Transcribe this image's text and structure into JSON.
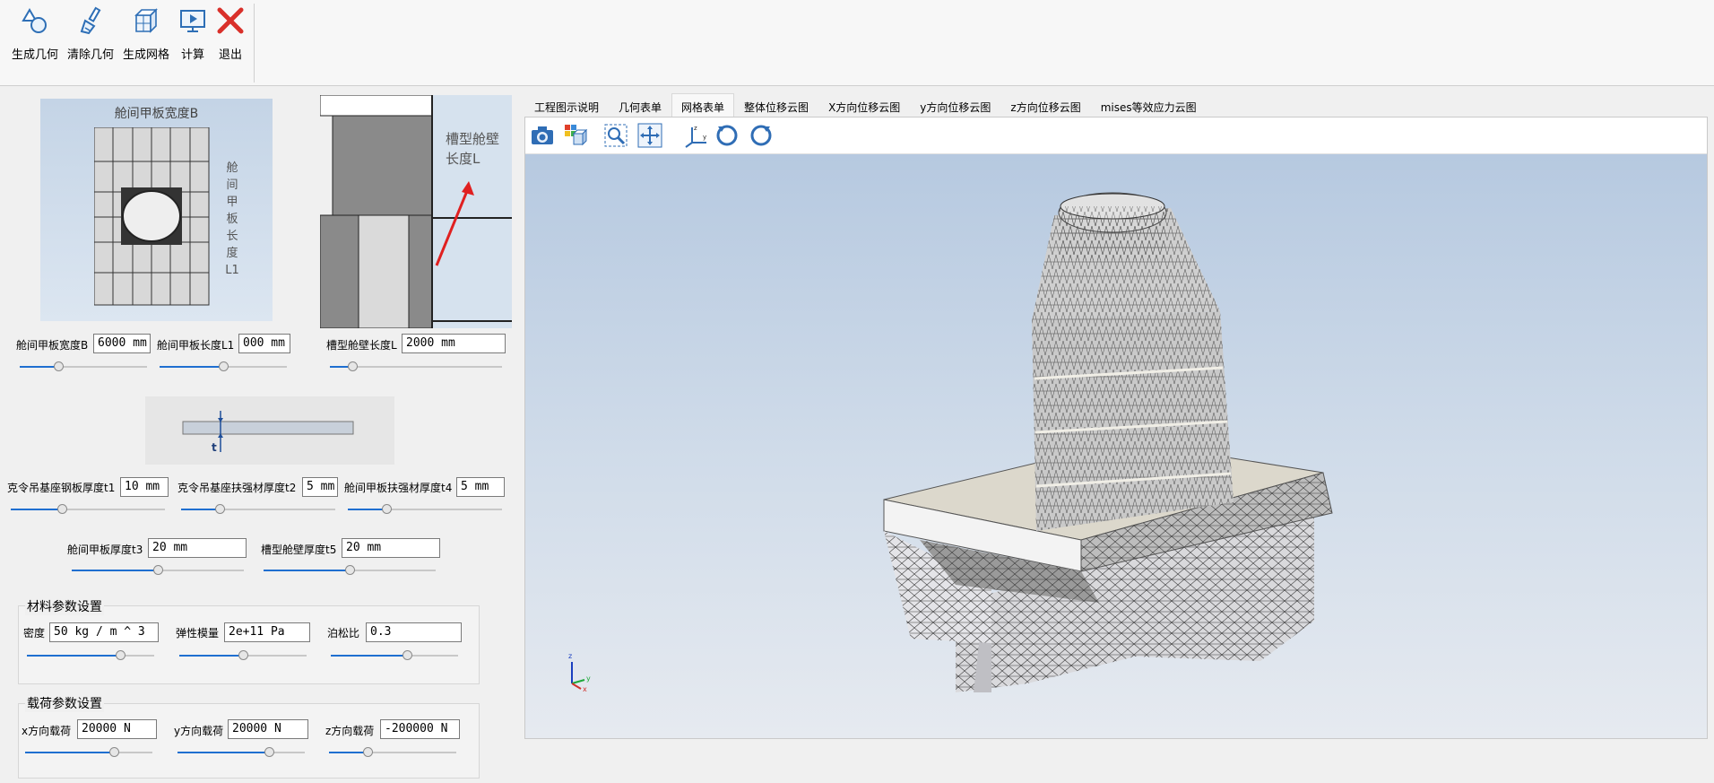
{
  "toolbar": {
    "buttons": [
      {
        "label": "生成几何",
        "icon": "shapes-icon"
      },
      {
        "label": "清除几何",
        "icon": "brush-icon"
      },
      {
        "label": "生成网格",
        "icon": "cube-grid-icon"
      },
      {
        "label": "计算",
        "icon": "monitor-play-icon"
      },
      {
        "label": "退出",
        "icon": "close-icon"
      }
    ]
  },
  "diagrams": {
    "deck_title": "舱间甲板宽度B",
    "deck_length_label": "舱间甲板长度L1",
    "bulkhead_label_1": "槽型舱壁",
    "bulkhead_label_2": "长度L",
    "thickness_marker": "t"
  },
  "params": {
    "deck_width": {
      "label": "舱间甲板宽度B",
      "value": "6000 mm",
      "slider": 0.3
    },
    "deck_length": {
      "label": "舱间甲板长度L1",
      "value": "000 mm",
      "slider": 0.5
    },
    "bulkhead_length": {
      "label": "槽型舱壁长度L",
      "value": "2000 mm",
      "slider": 0.13
    },
    "crane_base_t1": {
      "label": "克令吊基座钢板厚度t1",
      "value": "10 mm",
      "slider": 0.33
    },
    "crane_stiffener_t2": {
      "label": "克令吊基座扶强材厚度t2",
      "value": "5 mm",
      "slider": 0.25
    },
    "deck_stiffener_t4": {
      "label": "舱间甲板扶强材厚度t4",
      "value": "5 mm",
      "slider": 0.25
    },
    "deck_t3": {
      "label": "舱间甲板厚度t3",
      "value": "20 mm",
      "slider": 0.5
    },
    "bulkhead_t5": {
      "label": "槽型舱壁厚度t5",
      "value": "20 mm",
      "slider": 0.5
    }
  },
  "material": {
    "title": "材料参数设置",
    "density": {
      "label": "密度",
      "value": "50 kg / m ^ 3",
      "slider": 0.73
    },
    "modulus": {
      "label": "弹性模量",
      "value": "2e+11 Pa",
      "slider": 0.5
    },
    "poisson": {
      "label": "泊松比",
      "value": "0.3",
      "slider": 0.6
    }
  },
  "load": {
    "title": "载荷参数设置",
    "x": {
      "label": "x方向载荷",
      "value": "20000 N",
      "slider": 0.7
    },
    "y": {
      "label": "y方向载荷",
      "value": "20000 N",
      "slider": 0.72
    },
    "z": {
      "label": "z方向载荷",
      "value": "-200000 N",
      "slider": 0.3
    }
  },
  "tabs": [
    {
      "label": "工程图示说明",
      "active": false
    },
    {
      "label": "几何表单",
      "active": false
    },
    {
      "label": "网格表单",
      "active": true
    },
    {
      "label": "整体位移云图",
      "active": false
    },
    {
      "label": "X方向位移云图",
      "active": false
    },
    {
      "label": "y方向位移云图",
      "active": false
    },
    {
      "label": "z方向位移云图",
      "active": false
    },
    {
      "label": "mises等效应力云图",
      "active": false
    }
  ],
  "viewer_tools": [
    "camera-icon",
    "color-map-icon",
    "zoom-fit-icon",
    "pan-icon",
    "axes-icon",
    "rotate-left-icon",
    "rotate-right-icon"
  ],
  "axis_labels": {
    "z": "z",
    "y": "y",
    "x": "x"
  },
  "colors": {
    "accent": "#1f6fd0",
    "exit_red": "#d9302a",
    "scene_top": "#b6c9e0"
  }
}
